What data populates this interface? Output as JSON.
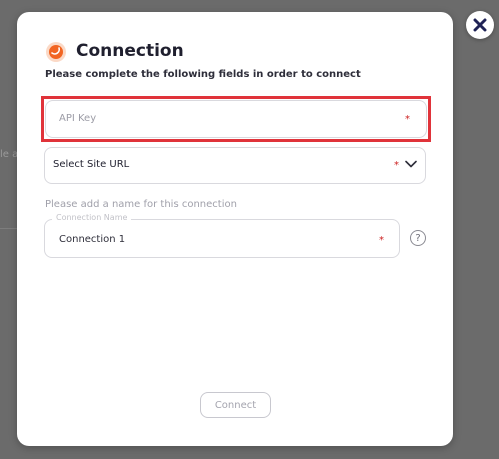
{
  "backdrop": {
    "partial_text": "le a"
  },
  "modal": {
    "title": "Connection",
    "subtitle": "Please complete the following fields in order to connect",
    "api_key": {
      "placeholder": "API Key",
      "required_mark": "*"
    },
    "site_url": {
      "value": "Select Site URL",
      "required_mark": "*"
    },
    "name_hint": "Please add a name for this connection",
    "connection_name": {
      "label": "Connection Name",
      "value": "Connection 1",
      "required_mark": "*"
    },
    "help_glyph": "?",
    "connect_label": "Connect"
  },
  "colors": {
    "overlay": "#6b6b6b",
    "highlight": "#e0333a",
    "required": "#cc1f1f",
    "logo": "#f26522"
  },
  "icons": {
    "close": "close-icon",
    "logo": "connection-logo-icon",
    "dropdown": "chevron-down-icon",
    "help": "help-icon"
  }
}
